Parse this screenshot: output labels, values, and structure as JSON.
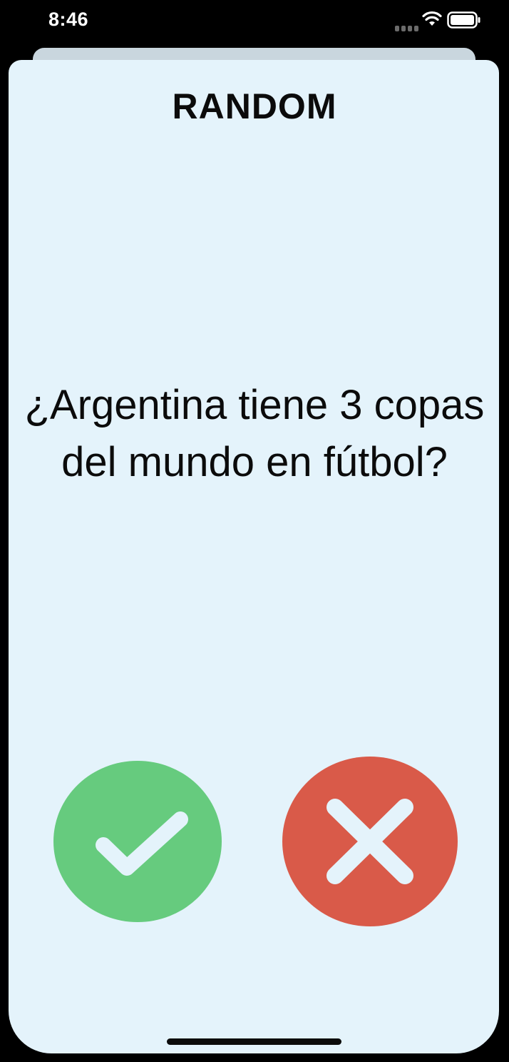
{
  "status_bar": {
    "time": "8:46",
    "icons": [
      "signal-icon",
      "wifi-icon",
      "battery-icon"
    ]
  },
  "card": {
    "title": "RANDOM",
    "question": "¿Argentina tiene 3 copas del mundo en fútbol?"
  },
  "answers": {
    "yes": {
      "icon": "checkmark-icon",
      "color": "#66cb7e"
    },
    "no": {
      "icon": "close-icon",
      "color": "#d95a49"
    }
  },
  "colors": {
    "card_background": "#e4f3fb",
    "back_sheet": "#c9d6de",
    "text": "#0b0b0b"
  }
}
